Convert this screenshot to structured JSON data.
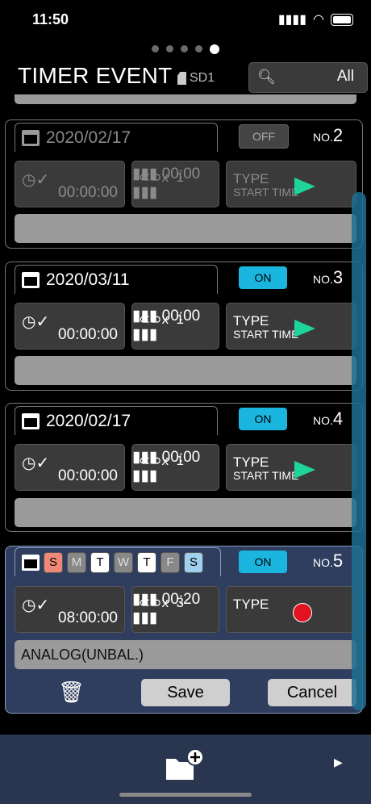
{
  "status": {
    "time": "11:50"
  },
  "header": {
    "title": "TIMER EVENT",
    "sd": "SD1",
    "search_value": "All"
  },
  "events": [
    {
      "date": "2020/02/17",
      "toggle": "OFF",
      "no_prefix": "NO.",
      "no": "2",
      "time": "00:00:00",
      "repeat_x": "x",
      "repeat_count": "1",
      "interval": "00:00",
      "type_label": "TYPE",
      "type_value": "START TIME",
      "source": ""
    },
    {
      "date": "2020/03/11",
      "toggle": "ON",
      "no_prefix": "NO.",
      "no": "3",
      "time": "00:00:00",
      "repeat_x": "x",
      "repeat_count": "1",
      "interval": "00:00",
      "type_label": "TYPE",
      "type_value": "START TIME",
      "source": ""
    },
    {
      "date": "2020/02/17",
      "toggle": "ON",
      "no_prefix": "NO.",
      "no": "4",
      "time": "00:00:00",
      "repeat_x": "x",
      "repeat_count": "1",
      "interval": "00:00",
      "type_label": "TYPE",
      "type_value": "START TIME",
      "source": ""
    },
    {
      "days": [
        "S",
        "M",
        "T",
        "W",
        "T",
        "F",
        "S"
      ],
      "toggle": "ON",
      "no_prefix": "NO.",
      "no": "5",
      "time": "08:00:00",
      "repeat_x": "x",
      "repeat_count": "3",
      "interval": "00:20",
      "type_label": "TYPE",
      "source": "ANALOG(UNBAL.)",
      "save_label": "Save",
      "cancel_label": "Cancel"
    }
  ],
  "icons": {
    "search": "search-icon",
    "calendar": "calendar-icon",
    "clock": "clock-check-icon",
    "loop": "loop-icon",
    "play": "play-icon",
    "rec": "record-icon",
    "trash": "trash-icon",
    "folder": "folder-add-icon",
    "next": "next-arrow-icon"
  },
  "colors": {
    "on": "#1ab6e0",
    "play": "#1fd39a",
    "rec": "#e0131f",
    "active_bg": "#2f3e5e"
  }
}
